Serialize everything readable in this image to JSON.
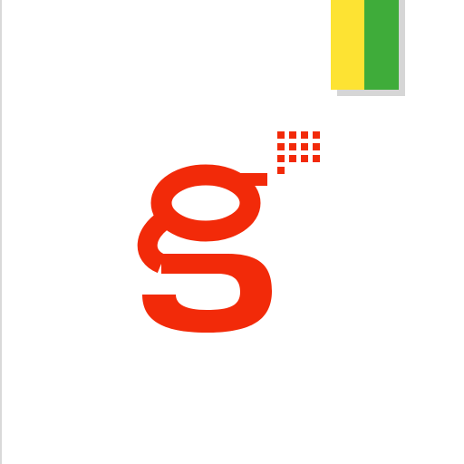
{
  "app_icon": {
    "name": "g-logo-app-icon",
    "logo_letter": "g",
    "logo_icon": "letter-g-with-dot-grid",
    "dot_grid": {
      "rows": 4,
      "cols": 4,
      "visible_dots": 13
    },
    "ribbon": {
      "stripes": [
        "yellow",
        "green"
      ]
    }
  },
  "colors": {
    "background": "#ffffff",
    "logo_red": "#f22a09",
    "ribbon_yellow": "#fde333",
    "ribbon_green": "#3fac3a",
    "ribbon_shadow": "#d6d6d6"
  }
}
